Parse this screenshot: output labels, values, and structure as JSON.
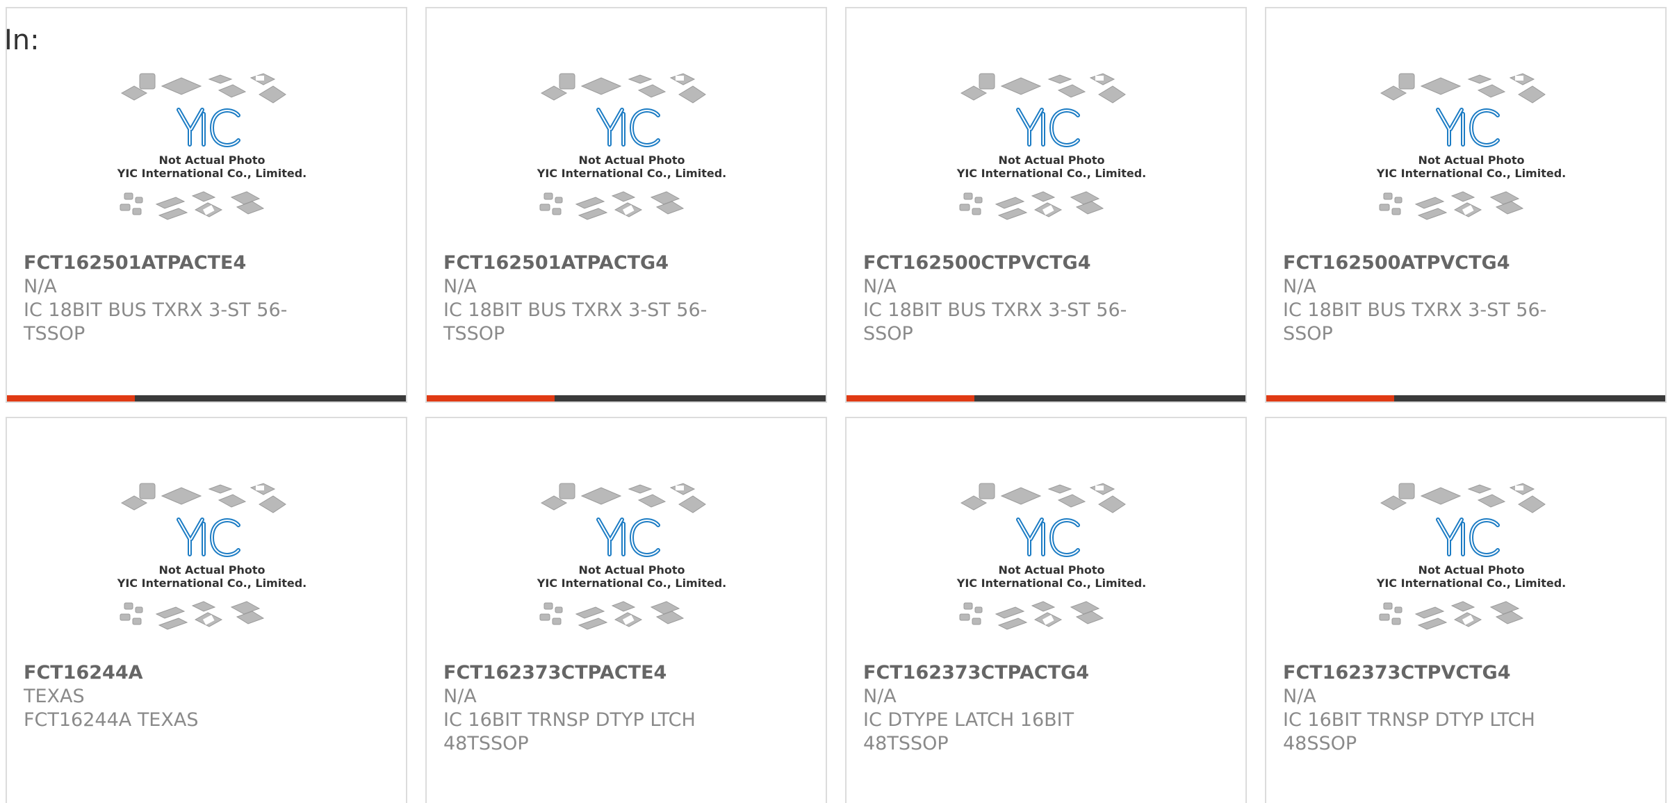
{
  "header": {
    "in_label": "In:"
  },
  "placeholder": {
    "line1": "Not Actual Photo",
    "line2": "YIC International Co., Limited.",
    "logo_text": "YIC"
  },
  "colors": {
    "accent": "#e03a14",
    "bar": "#3a3a3a",
    "logo_blue": "#1c7cc4"
  },
  "products": [
    {
      "part": "FCT162501ATPACTE4",
      "mfr": "N/A",
      "desc": "IC 18BIT BUS TXRX 3-ST 56-TSSOP"
    },
    {
      "part": "FCT162501ATPACTG4",
      "mfr": "N/A",
      "desc": "IC 18BIT BUS TXRX 3-ST 56-TSSOP"
    },
    {
      "part": "FCT162500CTPVCTG4",
      "mfr": "N/A",
      "desc": "IC 18BIT BUS TXRX 3-ST 56-SSOP"
    },
    {
      "part": "FCT162500ATPVCTG4",
      "mfr": "N/A",
      "desc": "IC 18BIT BUS TXRX 3-ST 56-SSOP"
    },
    {
      "part": "FCT16244A",
      "mfr": "TEXAS",
      "desc": "FCT16244A TEXAS"
    },
    {
      "part": "FCT162373CTPACTE4",
      "mfr": "N/A",
      "desc": "IC 16BIT TRNSP DTYP LTCH 48TSSOP"
    },
    {
      "part": "FCT162373CTPACTG4",
      "mfr": "N/A",
      "desc": "IC DTYPE LATCH 16BIT 48TSSOP"
    },
    {
      "part": "FCT162373CTPVCTG4",
      "mfr": "N/A",
      "desc": "IC 16BIT TRNSP DTYP LTCH 48SSOP"
    }
  ]
}
